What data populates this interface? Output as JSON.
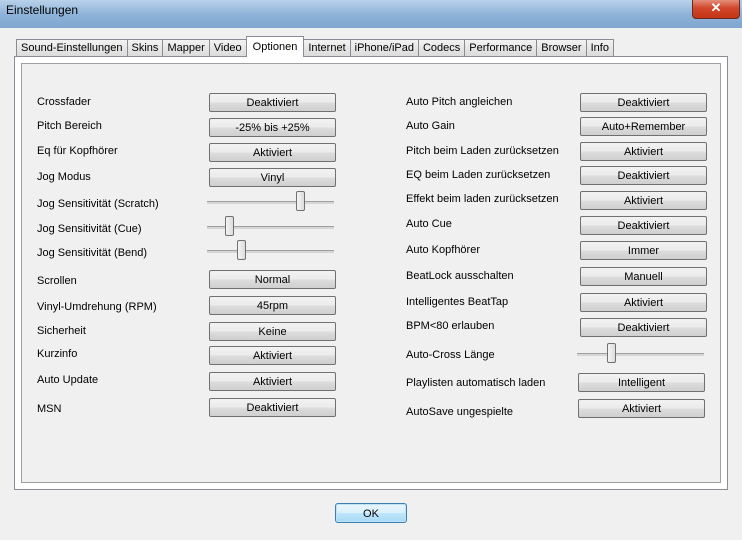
{
  "window": {
    "title": "Einstellungen",
    "close_glyph": "✕"
  },
  "tabs": [
    "Sound-Einstellungen",
    "Skins",
    "Mapper",
    "Video",
    "Optionen",
    "Internet",
    "iPhone/iPad",
    "Codecs",
    "Performance",
    "Browser",
    "Info"
  ],
  "active_tab": "Optionen",
  "left": {
    "crossfader": {
      "label": "Crossfader",
      "value": "Deaktiviert"
    },
    "pitch_bereich": {
      "label": "Pitch Bereich",
      "value": "-25% bis +25%"
    },
    "eq_kopfhoerer": {
      "label": "Eq für Kopfhörer",
      "value": "Aktiviert"
    },
    "jog_modus": {
      "label": "Jog Modus",
      "value": "Vinyl"
    },
    "jog_scratch": {
      "label": "Jog Sensitivität (Scratch)",
      "level": 0.75
    },
    "jog_cue": {
      "label": "Jog Sensitivität (Cue)",
      "level": 0.15
    },
    "jog_bend": {
      "label": "Jog Sensitivität (Bend)",
      "level": 0.25
    },
    "scrollen": {
      "label": "Scrollen",
      "value": "Normal"
    },
    "vinyl_umdrehung": {
      "label": "Vinyl-Umdrehung (RPM)",
      "value": "45rpm"
    },
    "sicherheit": {
      "label": "Sicherheit",
      "value": "Keine"
    },
    "kurzinfo": {
      "label": "Kurzinfo",
      "value": "Aktiviert"
    },
    "auto_update": {
      "label": "Auto Update",
      "value": "Aktiviert"
    },
    "msn": {
      "label": "MSN",
      "value": "Deaktiviert"
    }
  },
  "right": {
    "auto_pitch": {
      "label": "Auto Pitch angleichen",
      "value": "Deaktiviert"
    },
    "auto_gain": {
      "label": "Auto Gain",
      "value": "Auto+Remember"
    },
    "pitch_reset": {
      "label": "Pitch beim Laden zurücksetzen",
      "value": "Aktiviert"
    },
    "eq_reset": {
      "label": "EQ beim Laden zurücksetzen",
      "value": "Deaktiviert"
    },
    "effekt_reset": {
      "label": "Effekt beim laden zurücksetzen",
      "value": "Aktiviert"
    },
    "auto_cue": {
      "label": "Auto Cue",
      "value": "Deaktiviert"
    },
    "auto_kopfhoerer": {
      "label": "Auto Kopfhörer",
      "value": "Immer"
    },
    "beatlock": {
      "label": "BeatLock ausschalten",
      "value": "Manuell"
    },
    "beattap": {
      "label": "Intelligentes BeatTap",
      "value": "Aktiviert"
    },
    "bpm80": {
      "label": "BPM<80 erlauben",
      "value": "Deaktiviert"
    },
    "auto_cross": {
      "label": "Auto-Cross Länge",
      "level": 0.25
    },
    "playlisten": {
      "label": "Playlisten automatisch laden",
      "value": "Intelligent"
    },
    "autosave": {
      "label": "AutoSave ungespielte",
      "value": "Aktiviert"
    }
  },
  "ok_label": "OK"
}
